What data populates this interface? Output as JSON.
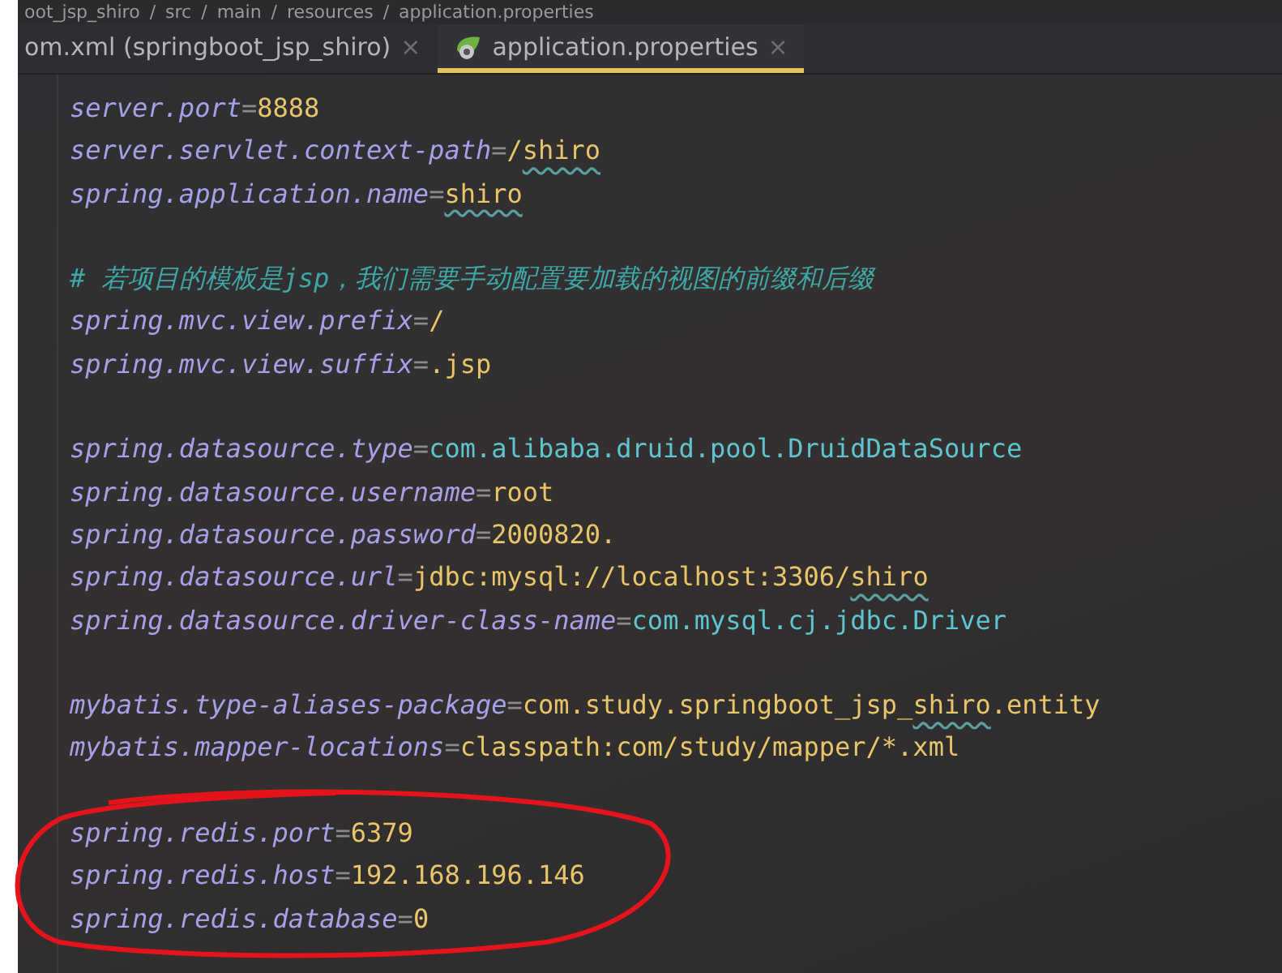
{
  "breadcrumb": [
    "oot_jsp_shiro",
    "/",
    "src",
    "/",
    "main",
    "/",
    "resources",
    "/",
    "application.properties"
  ],
  "tabs": [
    {
      "label": "om.xml (springboot_jsp_shiro)",
      "selected": false,
      "kind": "xml",
      "close": "×"
    },
    {
      "label": "application.properties",
      "selected": true,
      "kind": "properties",
      "close": "×"
    }
  ],
  "blocks": [
    {
      "circled": false,
      "lines": [
        [
          {
            "text": "server.port",
            "kind": "key"
          },
          {
            "text": "=",
            "kind": "sep"
          },
          {
            "text": "8888",
            "kind": "value"
          }
        ],
        [
          {
            "text": "server.servlet.context-path",
            "kind": "key"
          },
          {
            "text": "=",
            "kind": "sep"
          },
          {
            "text": "/",
            "kind": "value"
          },
          {
            "text": "shiro",
            "kind": "value",
            "typo": true
          }
        ],
        [
          {
            "text": "spring.application.name",
            "kind": "key"
          },
          {
            "text": "=",
            "kind": "sep"
          },
          {
            "text": "shiro",
            "kind": "value",
            "typo": true
          }
        ]
      ]
    },
    {
      "circled": false,
      "lines": [
        [
          {
            "text": "# 若项目的模板是jsp，我们需要手动配置要加载的视图的前缀和后缀",
            "kind": "comment"
          }
        ],
        [
          {
            "text": "spring.mvc.view.prefix",
            "kind": "key"
          },
          {
            "text": "=",
            "kind": "sep"
          },
          {
            "text": "/",
            "kind": "value"
          }
        ],
        [
          {
            "text": "spring.mvc.view.suffix",
            "kind": "key"
          },
          {
            "text": "=",
            "kind": "sep"
          },
          {
            "text": ".jsp",
            "kind": "value"
          }
        ]
      ]
    },
    {
      "circled": false,
      "lines": [
        [
          {
            "text": "spring.datasource.type",
            "kind": "key"
          },
          {
            "text": "=",
            "kind": "sep"
          },
          {
            "text": "com.alibaba.druid.pool.DruidDataSource",
            "kind": "class"
          }
        ],
        [
          {
            "text": "spring.datasource.username",
            "kind": "key"
          },
          {
            "text": "=",
            "kind": "sep"
          },
          {
            "text": "root",
            "kind": "value"
          }
        ],
        [
          {
            "text": "spring.datasource.password",
            "kind": "key"
          },
          {
            "text": "=",
            "kind": "sep"
          },
          {
            "text": "2000820.",
            "kind": "value"
          }
        ],
        [
          {
            "text": "spring.datasource.url",
            "kind": "key"
          },
          {
            "text": "=",
            "kind": "sep"
          },
          {
            "text": "jdbc:mysql://localhost:3306/",
            "kind": "value"
          },
          {
            "text": "shiro",
            "kind": "value",
            "typo": true
          }
        ],
        [
          {
            "text": "spring.datasource.driver-class-name",
            "kind": "key"
          },
          {
            "text": "=",
            "kind": "sep"
          },
          {
            "text": "com.mysql.cj.jdbc.Driver",
            "kind": "class"
          }
        ]
      ]
    },
    {
      "circled": false,
      "lines": [
        [
          {
            "text": "mybatis.type-aliases-package",
            "kind": "key"
          },
          {
            "text": "=",
            "kind": "sep"
          },
          {
            "text": "com.study.springboot_jsp_",
            "kind": "value"
          },
          {
            "text": "shiro",
            "kind": "value",
            "typo": true
          },
          {
            "text": ".entity",
            "kind": "value"
          }
        ],
        [
          {
            "text": "mybatis.mapper-locations",
            "kind": "key"
          },
          {
            "text": "=",
            "kind": "sep"
          },
          {
            "text": "classpath:com/study/mapper/*.xml",
            "kind": "value"
          }
        ]
      ]
    },
    {
      "circled": true,
      "lines": [
        [
          {
            "text": "spring.redis.port",
            "kind": "key"
          },
          {
            "text": "=",
            "kind": "sep"
          },
          {
            "text": "6379",
            "kind": "value"
          }
        ],
        [
          {
            "text": "spring.redis.host",
            "kind": "key"
          },
          {
            "text": "=",
            "kind": "sep"
          },
          {
            "text": "192.168.196.146",
            "kind": "value"
          }
        ],
        [
          {
            "text": "spring.redis.database",
            "kind": "key"
          },
          {
            "text": "=",
            "kind": "sep"
          },
          {
            "text": "0",
            "kind": "value"
          }
        ]
      ]
    }
  ]
}
